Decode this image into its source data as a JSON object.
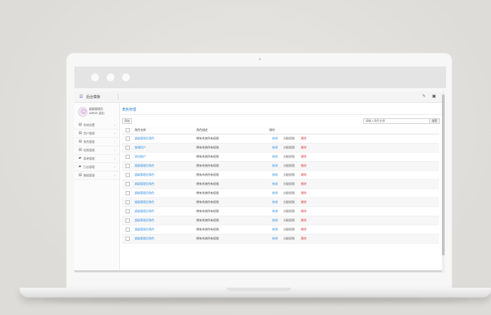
{
  "app": {
    "title": "后台模板"
  },
  "user": {
    "name": "超级管理员",
    "role": "admin 退出"
  },
  "sidebar": {
    "items": [
      {
        "label": "系统设置",
        "icon": "list-icon"
      },
      {
        "label": "用户管理",
        "icon": "list-icon"
      },
      {
        "label": "角色管理",
        "icon": "list-icon"
      },
      {
        "label": "权限管理",
        "icon": "list-icon"
      },
      {
        "label": "菜单管理",
        "icon": "folder-icon"
      },
      {
        "label": "日志管理",
        "icon": "folder-icon"
      },
      {
        "label": "数据管理",
        "icon": "list-icon"
      }
    ]
  },
  "main": {
    "page_title": "角色管理",
    "add_button": "添加",
    "search_placeholder": "请输入角色名称",
    "search_button": "搜索"
  },
  "table": {
    "headers": [
      "角色名称",
      "角色描述",
      "操作"
    ],
    "rows": [
      {
        "name": "超级管理员角色",
        "desc": "拥有系统所有权限"
      },
      {
        "name": "普通用户",
        "desc": "拥有系统所有权限"
      },
      {
        "name": "测试账户",
        "desc": "拥有系统所有权限"
      },
      {
        "name": "超级管理员角色",
        "desc": "拥有系统所有权限"
      },
      {
        "name": "超级管理员角色",
        "desc": "拥有系统所有权限"
      },
      {
        "name": "超级管理员角色",
        "desc": "拥有系统所有权限"
      },
      {
        "name": "超级管理员角色",
        "desc": "拥有系统所有权限"
      },
      {
        "name": "超级管理员角色",
        "desc": "拥有系统所有权限"
      },
      {
        "name": "超级管理员角色",
        "desc": "拥有系统所有权限"
      },
      {
        "name": "超级管理员角色",
        "desc": "拥有系统所有权限"
      },
      {
        "name": "超级管理员角色",
        "desc": "拥有系统所有权限"
      },
      {
        "name": "超级管理员角色",
        "desc": "拥有系统所有权限"
      }
    ],
    "actions": {
      "edit": "修改",
      "perm": "分配权限",
      "delete": "删除"
    }
  },
  "colors": {
    "link": "#2d8ce0",
    "danger": "#e23b3b",
    "accent": "#8a5bb0"
  }
}
